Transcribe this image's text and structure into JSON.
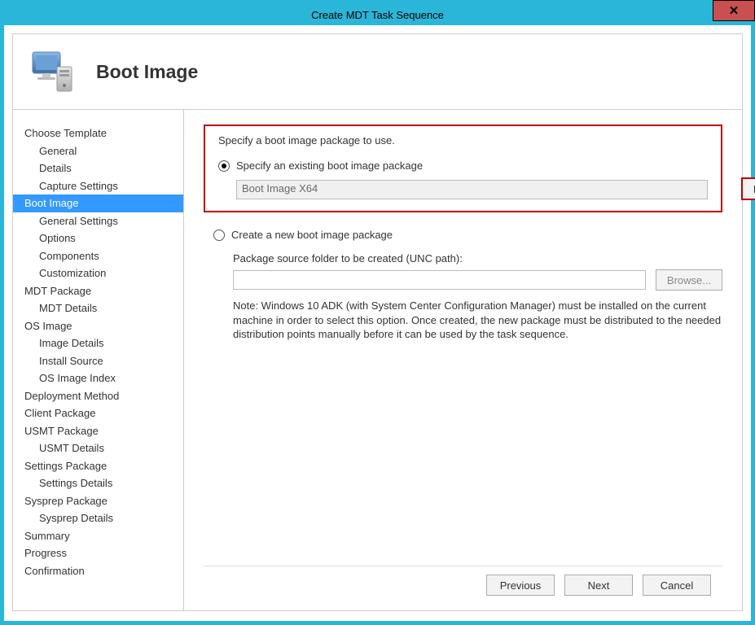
{
  "window": {
    "title": "Create MDT Task Sequence",
    "close_glyph": "✕"
  },
  "header": {
    "page_title": "Boot Image"
  },
  "sidebar": {
    "items": [
      {
        "label": "Choose Template",
        "child": false,
        "selected": false
      },
      {
        "label": "General",
        "child": true,
        "selected": false
      },
      {
        "label": "Details",
        "child": true,
        "selected": false
      },
      {
        "label": "Capture Settings",
        "child": true,
        "selected": false
      },
      {
        "label": "Boot Image",
        "child": false,
        "selected": true
      },
      {
        "label": "General Settings",
        "child": true,
        "selected": false
      },
      {
        "label": "Options",
        "child": true,
        "selected": false
      },
      {
        "label": "Components",
        "child": true,
        "selected": false
      },
      {
        "label": "Customization",
        "child": true,
        "selected": false
      },
      {
        "label": "MDT Package",
        "child": false,
        "selected": false
      },
      {
        "label": "MDT Details",
        "child": true,
        "selected": false
      },
      {
        "label": "OS Image",
        "child": false,
        "selected": false
      },
      {
        "label": "Image Details",
        "child": true,
        "selected": false
      },
      {
        "label": "Install Source",
        "child": true,
        "selected": false
      },
      {
        "label": "OS Image Index",
        "child": true,
        "selected": false
      },
      {
        "label": "Deployment Method",
        "child": false,
        "selected": false
      },
      {
        "label": "Client Package",
        "child": false,
        "selected": false
      },
      {
        "label": "USMT Package",
        "child": false,
        "selected": false
      },
      {
        "label": "USMT Details",
        "child": true,
        "selected": false
      },
      {
        "label": "Settings Package",
        "child": false,
        "selected": false
      },
      {
        "label": "Settings Details",
        "child": true,
        "selected": false
      },
      {
        "label": "Sysprep Package",
        "child": false,
        "selected": false
      },
      {
        "label": "Sysprep Details",
        "child": true,
        "selected": false
      },
      {
        "label": "Summary",
        "child": false,
        "selected": false
      },
      {
        "label": "Progress",
        "child": false,
        "selected": false
      },
      {
        "label": "Confirmation",
        "child": false,
        "selected": false
      }
    ]
  },
  "main": {
    "instruction": "Specify a boot image package to use.",
    "option_existing": {
      "label": "Specify an existing boot image package",
      "value": "Boot Image X64",
      "browse_label": "Browse..."
    },
    "option_create": {
      "label": "Create a new boot image package",
      "unc_label": "Package source folder to be created (UNC path):",
      "value": "",
      "browse_label": "Browse...",
      "note": "Note: Windows 10 ADK (with System Center Configuration Manager) must be installed on the current machine in order to select this option.  Once created, the new package must be distributed to the needed distribution points manually before it can be used by the task sequence."
    }
  },
  "footer": {
    "previous": "Previous",
    "next": "Next",
    "cancel": "Cancel"
  }
}
